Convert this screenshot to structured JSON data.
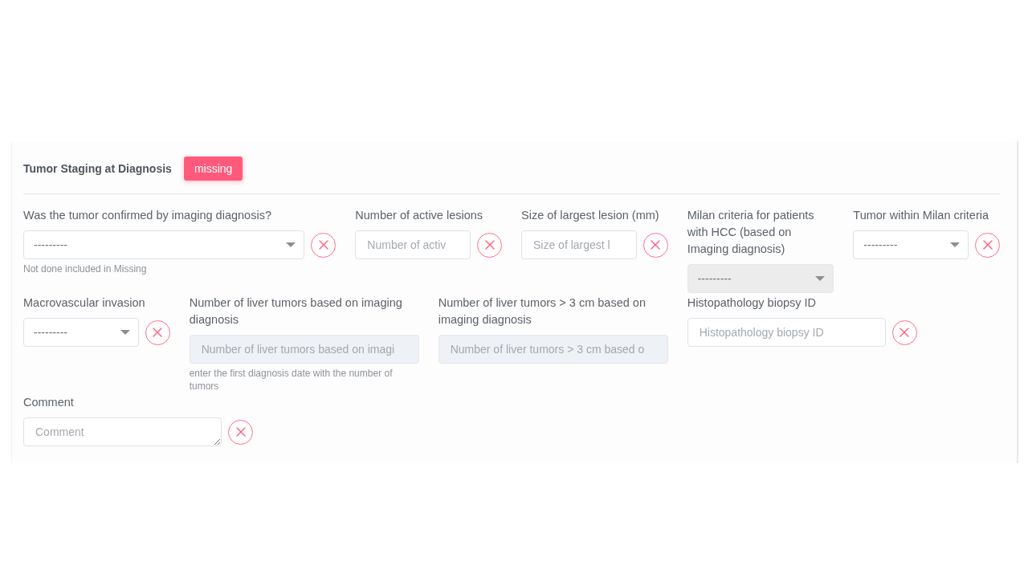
{
  "section": {
    "title": "Tumor Staging at Diagnosis",
    "badge": "missing"
  },
  "fields": [
    {
      "kind": "select",
      "label": "Was the tumor confirmed by imaging diagnosis?",
      "value": "---------",
      "disabled": false,
      "help": "Not done included in Missing"
    },
    {
      "kind": "input",
      "label": "Number of active lesions",
      "placeholder": "Number of activ",
      "disabled": false
    },
    {
      "kind": "input",
      "label": "Size of largest lesion (mm)",
      "placeholder": "Size of largest l",
      "disabled": false
    },
    {
      "kind": "select",
      "label": "Milan criteria for patients with HCC (based on Imaging diagnosis)",
      "value": "---------",
      "disabled": true
    },
    {
      "kind": "select",
      "label": "Tumor within Milan criteria",
      "value": "---------",
      "disabled": false
    },
    {
      "kind": "select",
      "label": "Macrovascular invasion",
      "value": "---------",
      "disabled": false
    },
    {
      "kind": "input",
      "label": "Number of liver tumors based on imaging diagnosis",
      "placeholder": "Number of liver tumors based on imagi",
      "disabled": true,
      "help": "enter the first diagnosis date with the number of tumors"
    },
    {
      "kind": "input",
      "label": "Number of liver tumors > 3 cm based on imaging diagnosis",
      "placeholder": "Number of liver tumors > 3 cm based o",
      "disabled": true
    },
    {
      "kind": "input",
      "label": "Histopathology biopsy ID",
      "placeholder": "Histopathology biopsy ID",
      "disabled": false
    },
    {
      "kind": "textarea",
      "label": "Comment",
      "placeholder": "Comment",
      "disabled": false
    }
  ]
}
